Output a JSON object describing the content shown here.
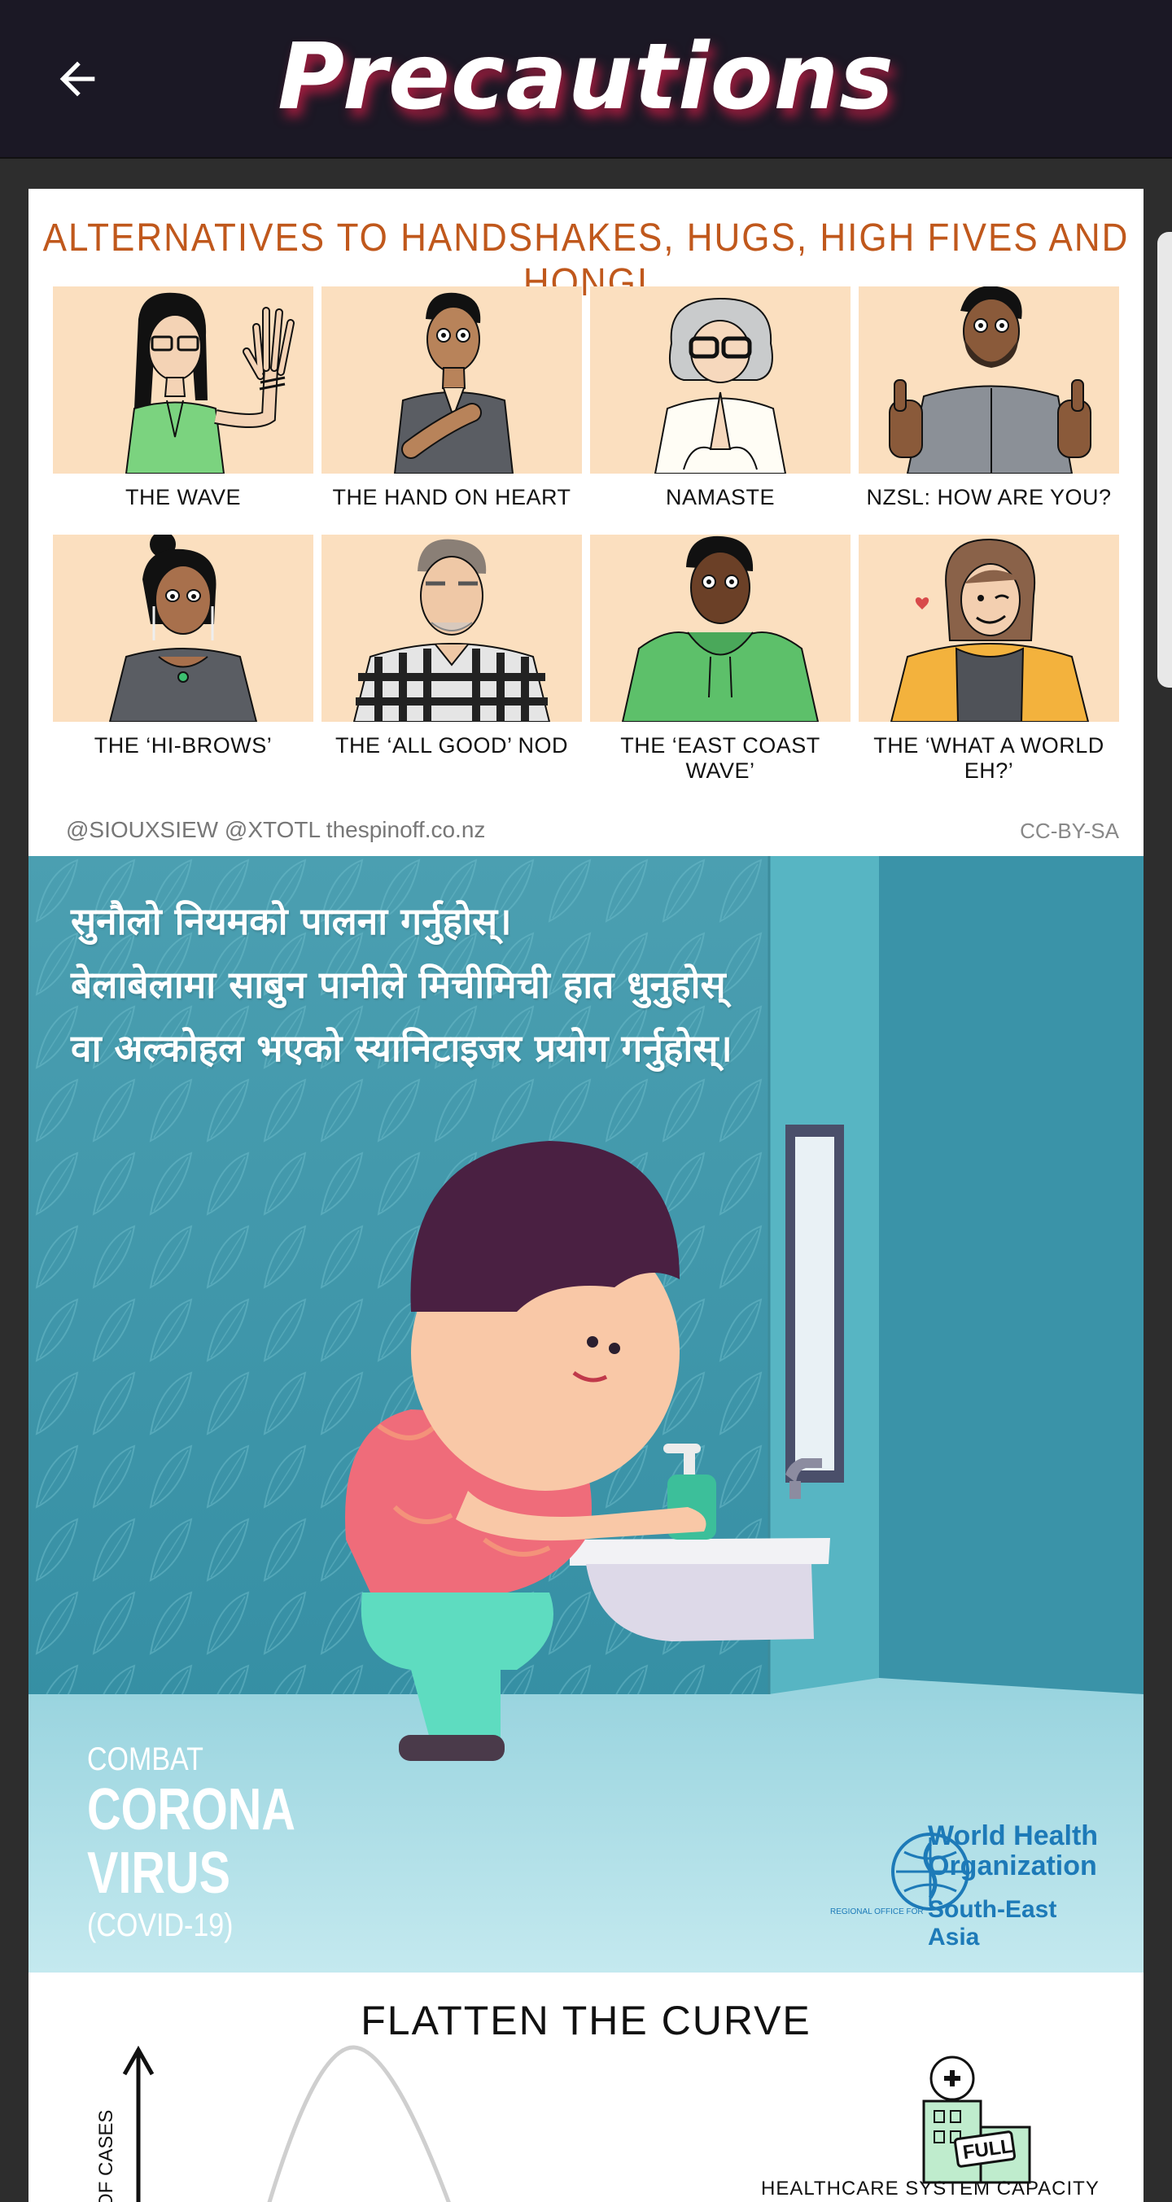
{
  "app_bar": {
    "title": "Precautions",
    "back_icon": "arrow-left-icon"
  },
  "colors": {
    "app_bar_bg": "#1b1825",
    "page_bg": "#2d2d2d",
    "title_glow": "#c81e46",
    "handshake_title": "#c0581c",
    "panel_peach": "#fbdfbf",
    "who_teal": "#3d94a8",
    "who_blue": "#1d7ab8"
  },
  "handshake_poster": {
    "title": "ALTERNATIVES TO HANDSHAKES, HUGS, HIGH FIVES AND HONGI",
    "greetings": [
      {
        "label": "THE WAVE"
      },
      {
        "label": "THE HAND ON HEART"
      },
      {
        "label": "NAMASTE"
      },
      {
        "label": "NZSL: HOW ARE YOU?"
      },
      {
        "label": "THE ‘HI-BROWS’"
      },
      {
        "label": "THE ‘ALL GOOD’ NOD"
      },
      {
        "label": "THE ‘EAST COAST WAVE’"
      },
      {
        "label": "THE ‘WHAT A WORLD EH?’"
      }
    ],
    "credit": "@SIOUXSIEW @XTOTL thespinoff.co.nz",
    "license": "CC-BY-SA"
  },
  "who_poster": {
    "lines": [
      "सुनौलो नियमको पालना गर्नुहोस्।",
      "बेलाबेलामा साबुन पानीले मिचीमिची हात धुनुहोस्",
      "वा अल्कोहल भएको स्यानिटाइजर प्रयोग गर्नुहोस्।"
    ],
    "combat_small": "COMBAT",
    "combat_line1": "CORONA",
    "combat_line2": "VIRUS",
    "combat_paren": "(COVID-19)",
    "org_line1": "World Health",
    "org_line2": "Organization",
    "region": "South-East Asia",
    "region_small": "REGIONAL OFFICE FOR"
  },
  "curve_poster": {
    "title": "FLATTEN THE CURVE",
    "y_label": "ER OF CASES",
    "capacity_label": "HEALTHCARE SYSTEM CAPACITY",
    "hospital_sign": "FULL"
  }
}
